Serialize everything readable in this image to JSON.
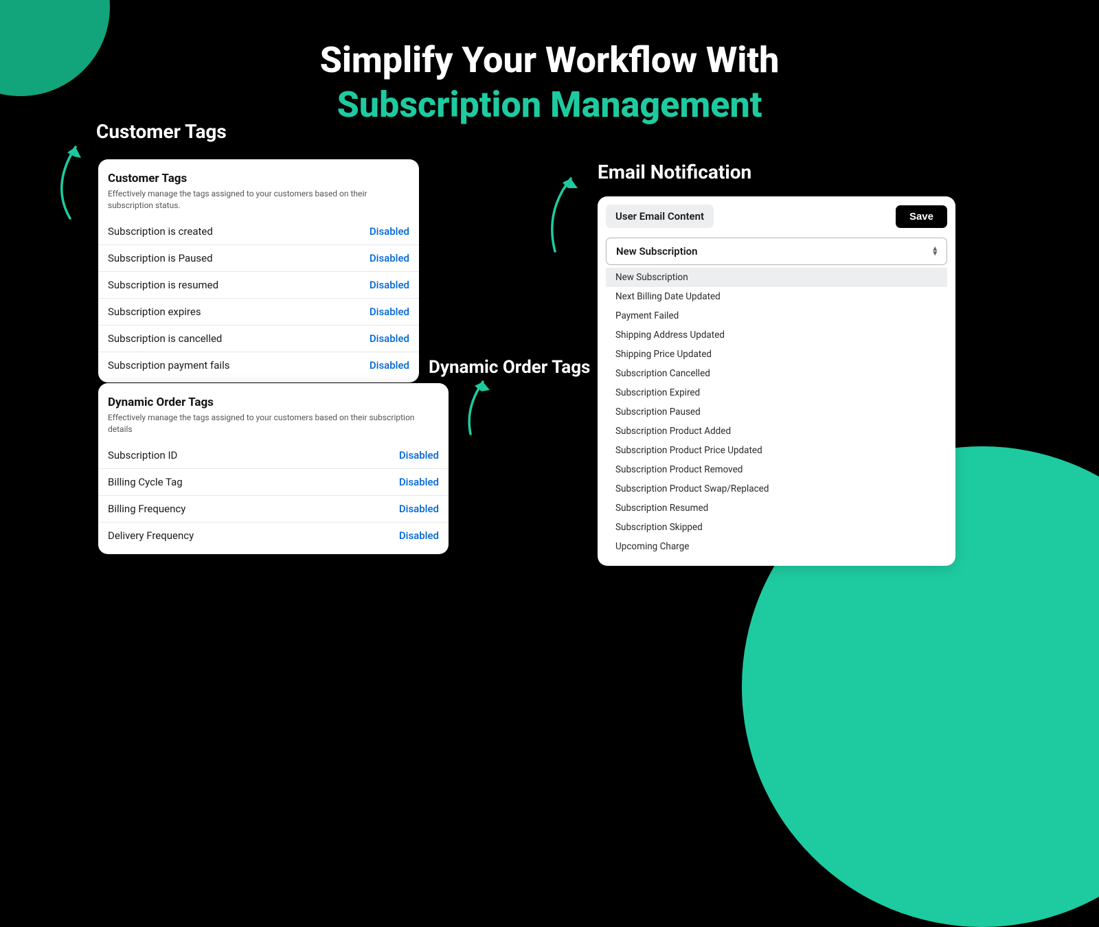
{
  "headline": {
    "line1": "Simplify Your Workflow With",
    "line2": "Subscription Management"
  },
  "labels": {
    "customer_tags": "Customer Tags",
    "dynamic_order_tags": "Dynamic Order Tags",
    "email_notification": "Email Notification"
  },
  "customer_tags_card": {
    "title": "Customer Tags",
    "subtitle": "Effectively manage the tags assigned to your customers based on their subscription status.",
    "rows": [
      {
        "label": "Subscription is created",
        "status": "Disabled"
      },
      {
        "label": "Subscription is Paused",
        "status": "Disabled"
      },
      {
        "label": "Subscription is resumed",
        "status": "Disabled"
      },
      {
        "label": "Subscription expires",
        "status": "Disabled"
      },
      {
        "label": "Subscription is cancelled",
        "status": "Disabled"
      },
      {
        "label": "Subscription payment fails",
        "status": "Disabled"
      }
    ]
  },
  "dynamic_tags_card": {
    "title": "Dynamic Order Tags",
    "subtitle": "Effectively manage the tags assigned to your customers based on their subscription details",
    "rows": [
      {
        "label": "Subscription ID",
        "status": "Disabled"
      },
      {
        "label": "Billing Cycle Tag",
        "status": "Disabled"
      },
      {
        "label": "Billing Frequency",
        "status": "Disabled"
      },
      {
        "label": "Delivery Frequency",
        "status": "Disabled"
      }
    ]
  },
  "email_card": {
    "tab_label": "User Email Content",
    "save_label": "Save",
    "selected": "New Subscription",
    "options": [
      "New Subscription",
      "Next Billing Date Updated",
      "Payment Failed",
      "Shipping Address Updated",
      "Shipping Price Updated",
      "Subscription Cancelled",
      "Subscription Expired",
      "Subscription Paused",
      "Subscription Product Added",
      "Subscription Product Price Updated",
      "Subscription Product Removed",
      "Subscription Product Swap/Replaced",
      "Subscription Resumed",
      "Subscription Skipped",
      "Upcoming Charge"
    ]
  }
}
